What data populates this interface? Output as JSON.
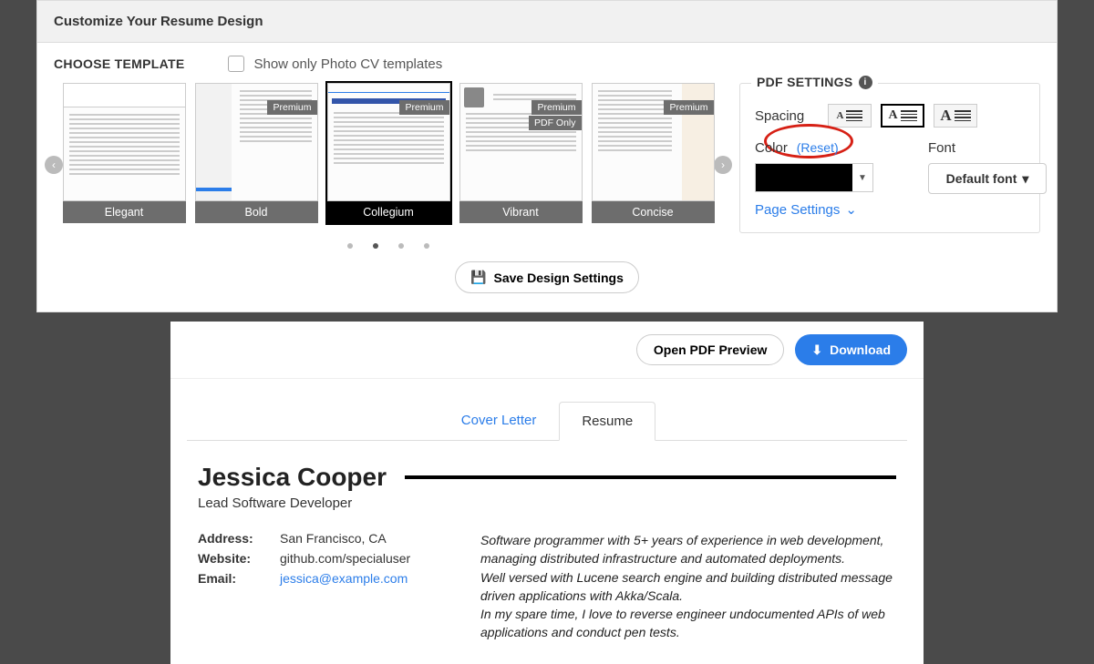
{
  "header": {
    "title": "Customize Your Resume Design"
  },
  "templates": {
    "choose_label": "CHOOSE TEMPLATE",
    "photo_filter_label": "Show only Photo CV templates",
    "items": [
      {
        "name": "Elegant",
        "premium": false
      },
      {
        "name": "Bold",
        "premium": true
      },
      {
        "name": "Collegium",
        "premium": true
      },
      {
        "name": "Vibrant",
        "premium": true,
        "pdf_only": true
      },
      {
        "name": "Concise",
        "premium": true
      }
    ],
    "premium_badge": "Premium",
    "pdf_only_badge": "PDF Only",
    "selected_index": 2,
    "page_count": 4,
    "active_page": 1
  },
  "pdf": {
    "title": "PDF SETTINGS",
    "spacing_label": "Spacing",
    "spacing_selected": 1,
    "color_label": "Color",
    "reset_label": "(Reset)",
    "font_label": "Font",
    "font_value": "Default font",
    "color_value": "#000000",
    "page_settings_label": "Page Settings",
    "save_label": "Save Design Settings"
  },
  "preview": {
    "open_pdf_label": "Open PDF Preview",
    "download_label": "Download",
    "tabs": {
      "cover": "Cover Letter",
      "resume": "Resume",
      "active": "resume"
    }
  },
  "resume": {
    "name": "Jessica Cooper",
    "role": "Lead Software Developer",
    "contact": {
      "address_label": "Address:",
      "address_value": "San Francisco, CA",
      "website_label": "Website:",
      "website_value": "github.com/specialuser",
      "email_label": "Email:",
      "email_value": "jessica@example.com"
    },
    "summary_lines": [
      "Software programmer with 5+ years of experience in web development, managing distributed infrastructure and automated deployments.",
      "Well versed with Lucene search engine and building distributed message driven applications with Akka/Scala.",
      "In my spare time, I love to reverse engineer undocumented APIs of web applications and conduct pen tests."
    ]
  }
}
